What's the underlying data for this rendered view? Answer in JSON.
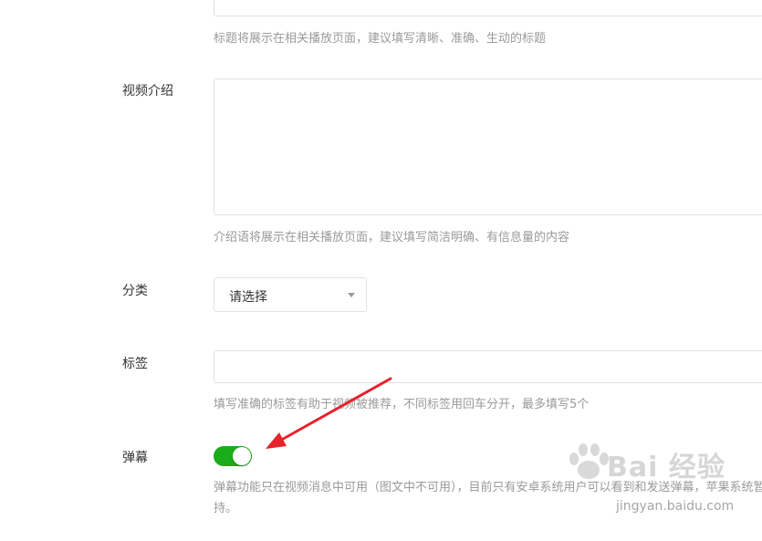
{
  "title_field": {
    "hint": "标题将展示在相关播放页面，建议填写清晰、准确、生动的标题"
  },
  "intro_field": {
    "label": "视频介绍",
    "value": "",
    "hint": "介绍语将展示在相关播放页面，建议填写简洁明确、有信息量的内容"
  },
  "category_field": {
    "label": "分类",
    "selected": "请选择"
  },
  "tags_field": {
    "label": "标签",
    "value": "",
    "hint": "填写准确的标签有助于视频被推荐，不同标签用回车分开，最多填写5个"
  },
  "danmaku_field": {
    "label": "弹幕",
    "enabled": true,
    "hint": "弹幕功能只在视频消息中可用（图文中不可用），目前只有安卓系统用户可以看到和发送弹幕，苹果系统暂不支持。"
  },
  "annotation": {
    "arrow_color": "#e8212b"
  },
  "watermark": {
    "logo": "Bai 经验",
    "url": "jingyan.baidu.com"
  },
  "colors": {
    "toggle_on": "#1aad19",
    "hint_text": "#9a9a9a",
    "border": "#e2e2e2"
  }
}
